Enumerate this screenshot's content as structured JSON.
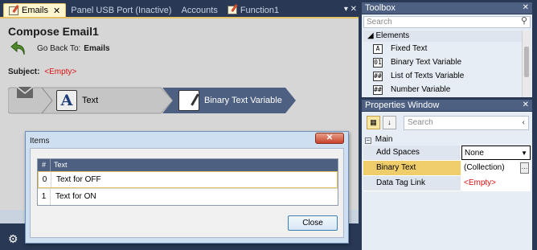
{
  "tabs": [
    {
      "label": "Emails",
      "active": true
    },
    {
      "label": "Panel USB Port (Inactive)",
      "active": false
    },
    {
      "label": "Accounts",
      "active": false
    },
    {
      "label": "Function1",
      "active": false
    }
  ],
  "tabs_controls": "▾ ✕",
  "document": {
    "title": "Compose Email1",
    "goback_label": "Go Back To:",
    "goback_target": "Emails",
    "subject_label": "Subject:",
    "subject_value": "<Empty>",
    "flow": {
      "step1_label": "Text",
      "step2_label": "Binary Text Variable",
      "step2_icon_line1": "01",
      "step2_icon_line2": "01"
    }
  },
  "dialog": {
    "title": "Items",
    "close_x": "✕",
    "columns": [
      "#",
      "Text"
    ],
    "rows": [
      {
        "index": "0",
        "text": "Text for OFF"
      },
      {
        "index": "1",
        "text": "Text for ON"
      }
    ],
    "close_button": "Close"
  },
  "toolbox": {
    "title": "Toolbox",
    "close": "✕",
    "search_placeholder": "Search",
    "category": "Elements",
    "items": [
      {
        "label": "Fixed Text",
        "icon": "A"
      },
      {
        "label": "Binary Text Variable",
        "icon": "01"
      },
      {
        "label": "List of Texts Variable",
        "icon": "##"
      },
      {
        "label": "Number Variable",
        "icon": "##"
      }
    ]
  },
  "properties": {
    "title": "Properties Window",
    "close": "✕",
    "search_placeholder": "Search",
    "category": "Main",
    "rows": [
      {
        "key": "Add Spaces",
        "value": "None"
      },
      {
        "key": "Binary Text",
        "value": "(Collection)"
      },
      {
        "key": "Data Tag Link",
        "value": "<Empty>"
      }
    ]
  },
  "colors": {
    "background": "#293955",
    "pane_header": "#4d6082",
    "active_tab": "#fff6cf",
    "selected_accent": "#efcd6b",
    "empty_red": "#d11"
  },
  "icons": [
    "document-icon",
    "go-back-arrow-icon",
    "envelope-icon",
    "fixed-text-icon",
    "binary-text-icon",
    "search-icon",
    "close-icon",
    "gear-icon",
    "categorized-icon",
    "sort-az-icon"
  ]
}
